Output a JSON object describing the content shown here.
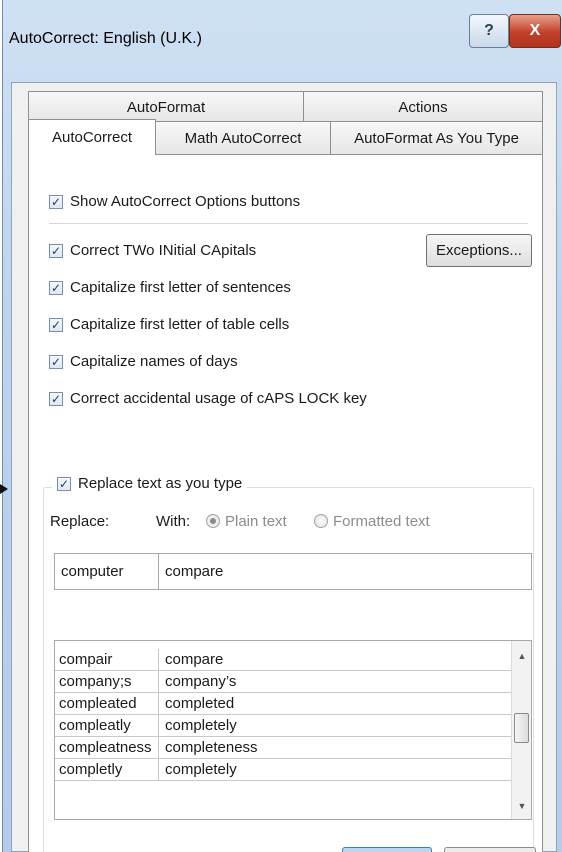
{
  "window": {
    "title": "AutoCorrect: English (U.K.)",
    "help_glyph": "?",
    "close_glyph": "X"
  },
  "tabs": {
    "row1": [
      "AutoFormat",
      "Actions"
    ],
    "row2": [
      "AutoCorrect",
      "Math AutoCorrect",
      "AutoFormat As You Type"
    ],
    "active": "AutoCorrect"
  },
  "options": {
    "show_buttons": "Show AutoCorrect Options buttons",
    "correct_two_initial": "Correct TWo INitial CApitals",
    "capitalize_sentences": "Capitalize first letter of sentences",
    "capitalize_table_cells": "Capitalize first letter of table cells",
    "capitalize_days": "Capitalize names of days",
    "caps_lock": "Correct accidental usage of cAPS LOCK key",
    "exceptions_button": "Exceptions..."
  },
  "replace": {
    "checkbox_label": "Replace text as you type",
    "replace_label": "Replace:",
    "with_label": "With:",
    "plain_text": "Plain text",
    "formatted_text": "Formatted text",
    "replace_value": "computer",
    "with_value": "compare",
    "entries": [
      [
        "compair",
        "compare"
      ],
      [
        "company;s",
        "company’s"
      ],
      [
        "compleated",
        "completed"
      ],
      [
        "compleatly",
        "completely"
      ],
      [
        "compleatness",
        "completeness"
      ],
      [
        "completly",
        "completely"
      ]
    ]
  },
  "colors": {
    "accent": "#1c3c80",
    "close_button": "#c0402a"
  }
}
